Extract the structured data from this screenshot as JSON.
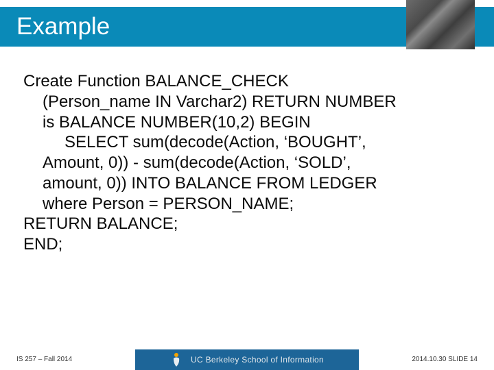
{
  "header": {
    "title": "Example"
  },
  "code": {
    "l1": "Create Function BALANCE_CHECK",
    "l2": "(Person_name IN Varchar2) RETURN NUMBER",
    "l3": "is BALANCE NUMBER(10,2) BEGIN",
    "l4": "SELECT sum(decode(Action, ‘BOUGHT’,",
    "l5": "Amount, 0)) - sum(decode(Action, ‘SOLD’,",
    "l6": "amount, 0)) INTO BALANCE FROM LEDGER",
    "l7": "where Person = PERSON_NAME;",
    "l8": "RETURN BALANCE;",
    "l9": "END;"
  },
  "footer": {
    "left": "IS 257 – Fall 2014",
    "center": "UC Berkeley School of Information",
    "right": "2014.10.30 SLIDE 14"
  }
}
